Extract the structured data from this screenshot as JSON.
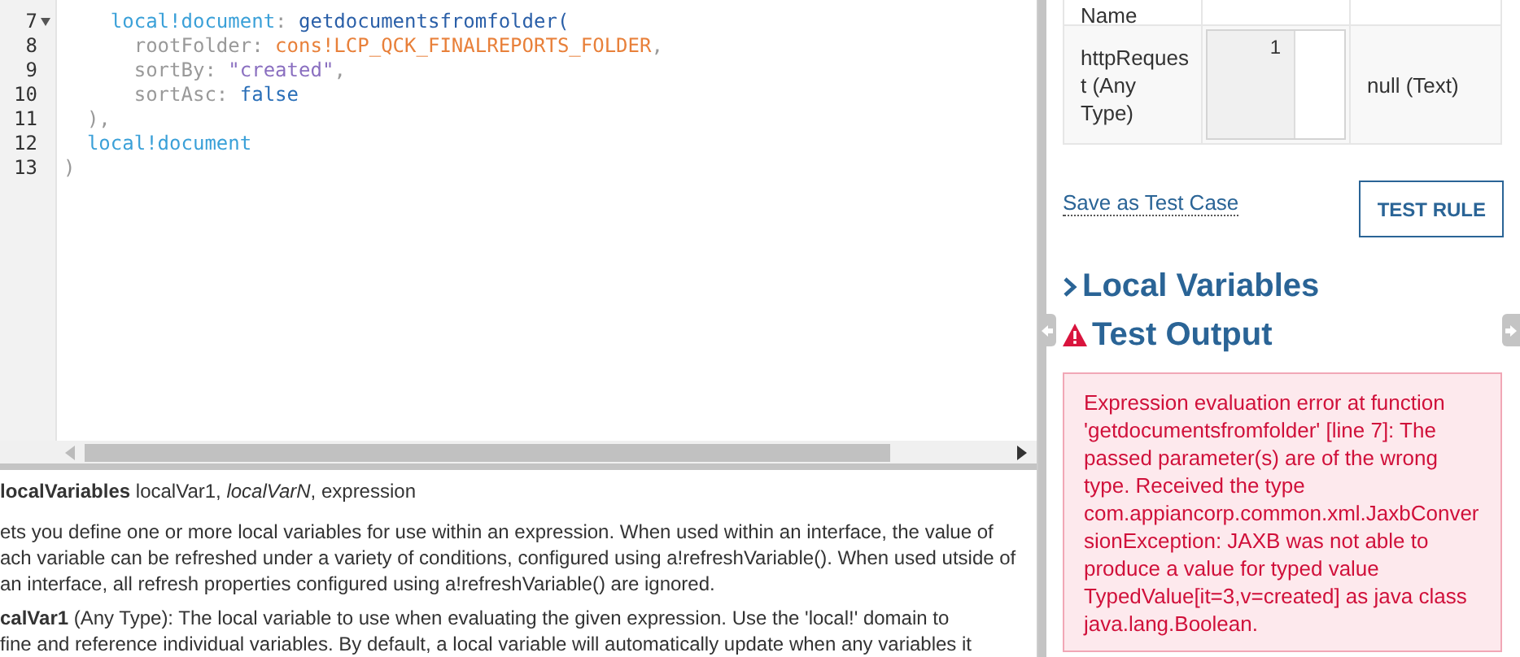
{
  "editor": {
    "lines": [
      {
        "number": "7",
        "foldable": true,
        "tokens": [
          {
            "kind": "var",
            "text": "    local!document"
          },
          {
            "kind": "plain",
            "text": ": "
          },
          {
            "kind": "func",
            "text": "getdocumentsfromfolder("
          }
        ]
      },
      {
        "number": "8",
        "foldable": false,
        "tokens": [
          {
            "kind": "plain",
            "text": "      rootFolder: "
          },
          {
            "kind": "const",
            "text": "cons!LCP_QCK_FINALREPORTS_FOLDER"
          },
          {
            "kind": "plain",
            "text": ","
          }
        ]
      },
      {
        "number": "9",
        "foldable": false,
        "tokens": [
          {
            "kind": "plain",
            "text": "      sortBy: "
          },
          {
            "kind": "string",
            "text": "\"created\""
          },
          {
            "kind": "plain",
            "text": ","
          }
        ]
      },
      {
        "number": "10",
        "foldable": false,
        "tokens": [
          {
            "kind": "plain",
            "text": "      sortAsc: "
          },
          {
            "kind": "keyword",
            "text": "false"
          }
        ]
      },
      {
        "number": "11",
        "foldable": false,
        "tokens": [
          {
            "kind": "plain",
            "text": "  ),"
          }
        ]
      },
      {
        "number": "12",
        "foldable": false,
        "tokens": [
          {
            "kind": "var",
            "text": "  local!document"
          }
        ]
      },
      {
        "number": "13",
        "foldable": false,
        "tokens": [
          {
            "kind": "plain",
            "text": ")"
          }
        ]
      }
    ]
  },
  "documentation": {
    "function_name": "localVariables",
    "signature": "localVar1, *localVarN*, expression",
    "description": "ets you define one or more local variables for use within an expression. When used within an interface, the value of ach variable can be refreshed under a variety of conditions, configured using a!refreshVariable(). When used utside of an interface, all refresh properties configured using a!refreshVariable() are ignored.",
    "parameter": "**calVar1** (Any Type): The local variable to use when evaluating the given expression. Use the 'local!' domain to",
    "parameter_cont": "fine and reference individual variables. By default, a local variable will automatically update when any variables it"
  },
  "test_inputs": {
    "columns": [
      "Name"
    ],
    "rows": [
      {
        "name": "httpRequest (Any Type)",
        "line_number": "1",
        "value": "null (Text)"
      }
    ]
  },
  "save_link": "Save as Test Case",
  "test_button": "TEST RULE",
  "sections": [
    {
      "kind": "collapsed",
      "title": "Local Variables"
    },
    {
      "kind": "error",
      "title": "Test Output"
    }
  ],
  "error_message": "Expression evaluation error at function 'getdocumentsfromfolder' [line 7]: The passed parameter(s) are of the wrong type. Received the type com.appiancorp.common.xml.JaxbConversionException: JAXB was not able to produce a value for typed value TypedValue[it=3,v=created] as java class java.lang.Boolean."
}
